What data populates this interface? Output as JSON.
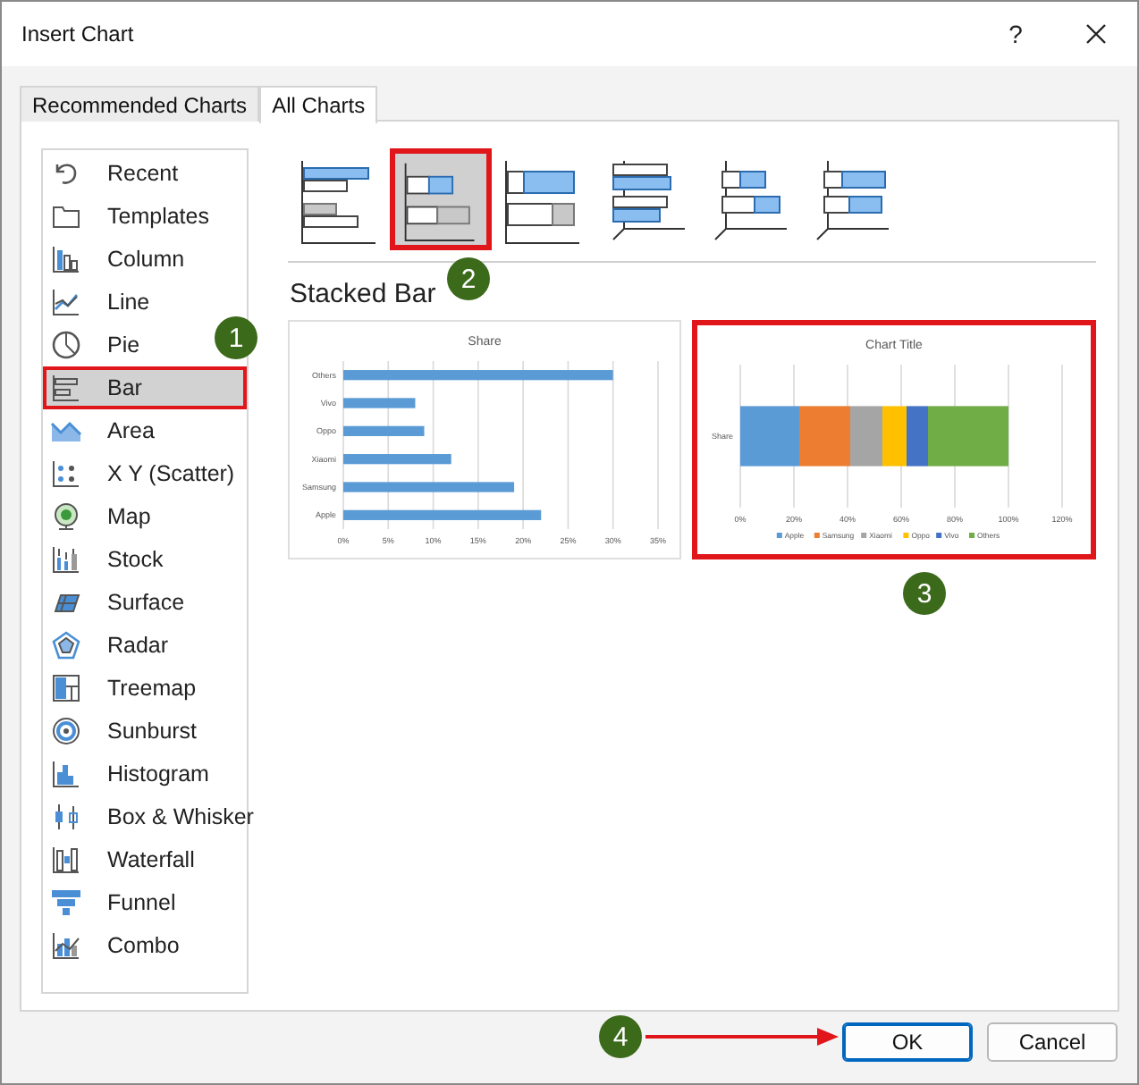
{
  "window": {
    "title": "Insert Chart",
    "help": "?"
  },
  "tabs": [
    {
      "label": "Recommended Charts",
      "selected": false
    },
    {
      "label": "All Charts",
      "selected": true
    }
  ],
  "sidebar": {
    "items": [
      {
        "label": "Recent",
        "selected": false
      },
      {
        "label": "Templates",
        "selected": false
      },
      {
        "label": "Column",
        "selected": false
      },
      {
        "label": "Line",
        "selected": false
      },
      {
        "label": "Pie",
        "selected": false
      },
      {
        "label": "Bar",
        "selected": true
      },
      {
        "label": "Area",
        "selected": false
      },
      {
        "label": "X Y (Scatter)",
        "selected": false
      },
      {
        "label": "Map",
        "selected": false
      },
      {
        "label": "Stock",
        "selected": false
      },
      {
        "label": "Surface",
        "selected": false
      },
      {
        "label": "Radar",
        "selected": false
      },
      {
        "label": "Treemap",
        "selected": false
      },
      {
        "label": "Sunburst",
        "selected": false
      },
      {
        "label": "Histogram",
        "selected": false
      },
      {
        "label": "Box & Whisker",
        "selected": false
      },
      {
        "label": "Waterfall",
        "selected": false
      },
      {
        "label": "Funnel",
        "selected": false
      },
      {
        "label": "Combo",
        "selected": false
      }
    ]
  },
  "subtypes": [
    {
      "selected": false
    },
    {
      "selected": true
    },
    {
      "selected": false
    },
    {
      "selected": false
    },
    {
      "selected": false
    },
    {
      "selected": false
    }
  ],
  "subtype_title": "Stacked Bar",
  "previews": [
    {
      "highlighted": false,
      "chart_data": {
        "type": "bar",
        "orientation": "horizontal",
        "title": "Share",
        "categories": [
          "Others",
          "Vivo",
          "Oppo",
          "Xiaomi",
          "Samsung",
          "Apple"
        ],
        "series": [
          {
            "color": "#5b9bd5",
            "values": [
              0.3,
              0.08,
              0.09,
              0.12,
              0.19,
              0.22
            ]
          }
        ],
        "grid": true,
        "xticks": [
          {
            "value": 0,
            "label": "0%"
          },
          {
            "value": 0.05,
            "label": "5%"
          },
          {
            "value": 0.1,
            "label": "10%"
          },
          {
            "value": 0.15,
            "label": "15%"
          },
          {
            "value": 0.2,
            "label": "20%"
          },
          {
            "value": 0.25,
            "label": "25%"
          },
          {
            "value": 0.3,
            "label": "30%"
          },
          {
            "value": 0.35,
            "label": "35%"
          }
        ],
        "xlim": [
          0,
          0.35
        ]
      }
    },
    {
      "highlighted": true,
      "chart_data": {
        "type": "bar",
        "orientation": "horizontal",
        "stacked": true,
        "title": "Chart Title",
        "categories": [
          "Share"
        ],
        "series": [
          {
            "name": "Apple",
            "color": "#5b9bd5",
            "values": [
              0.22
            ]
          },
          {
            "name": "Samsung",
            "color": "#ed7d31",
            "values": [
              0.19
            ]
          },
          {
            "name": "Xiaomi",
            "color": "#a5a5a5",
            "values": [
              0.12
            ]
          },
          {
            "name": "Oppo",
            "color": "#ffc000",
            "values": [
              0.09
            ]
          },
          {
            "name": "Vivo",
            "color": "#4472c4",
            "values": [
              0.08
            ]
          },
          {
            "name": "Others",
            "color": "#70ad47",
            "values": [
              0.3
            ]
          }
        ],
        "xticks": [
          {
            "value": 0,
            "label": "0%"
          },
          {
            "value": 0.2,
            "label": "20%"
          },
          {
            "value": 0.4,
            "label": "40%"
          },
          {
            "value": 0.6,
            "label": "60%"
          },
          {
            "value": 0.8,
            "label": "80%"
          },
          {
            "value": 1,
            "label": "100%"
          },
          {
            "value": 1.2,
            "label": "120%"
          }
        ],
        "xlim": [
          0,
          1.2
        ],
        "grid": true,
        "legend": "bottom"
      }
    }
  ],
  "buttons": [
    {
      "label": "OK",
      "default": true
    },
    {
      "label": "Cancel",
      "default": false
    }
  ],
  "markers": [
    {
      "label": "1",
      "arrow": false
    },
    {
      "label": "2",
      "arrow": false
    },
    {
      "label": "3",
      "arrow": false
    },
    {
      "label": "4",
      "arrow": true
    }
  ]
}
